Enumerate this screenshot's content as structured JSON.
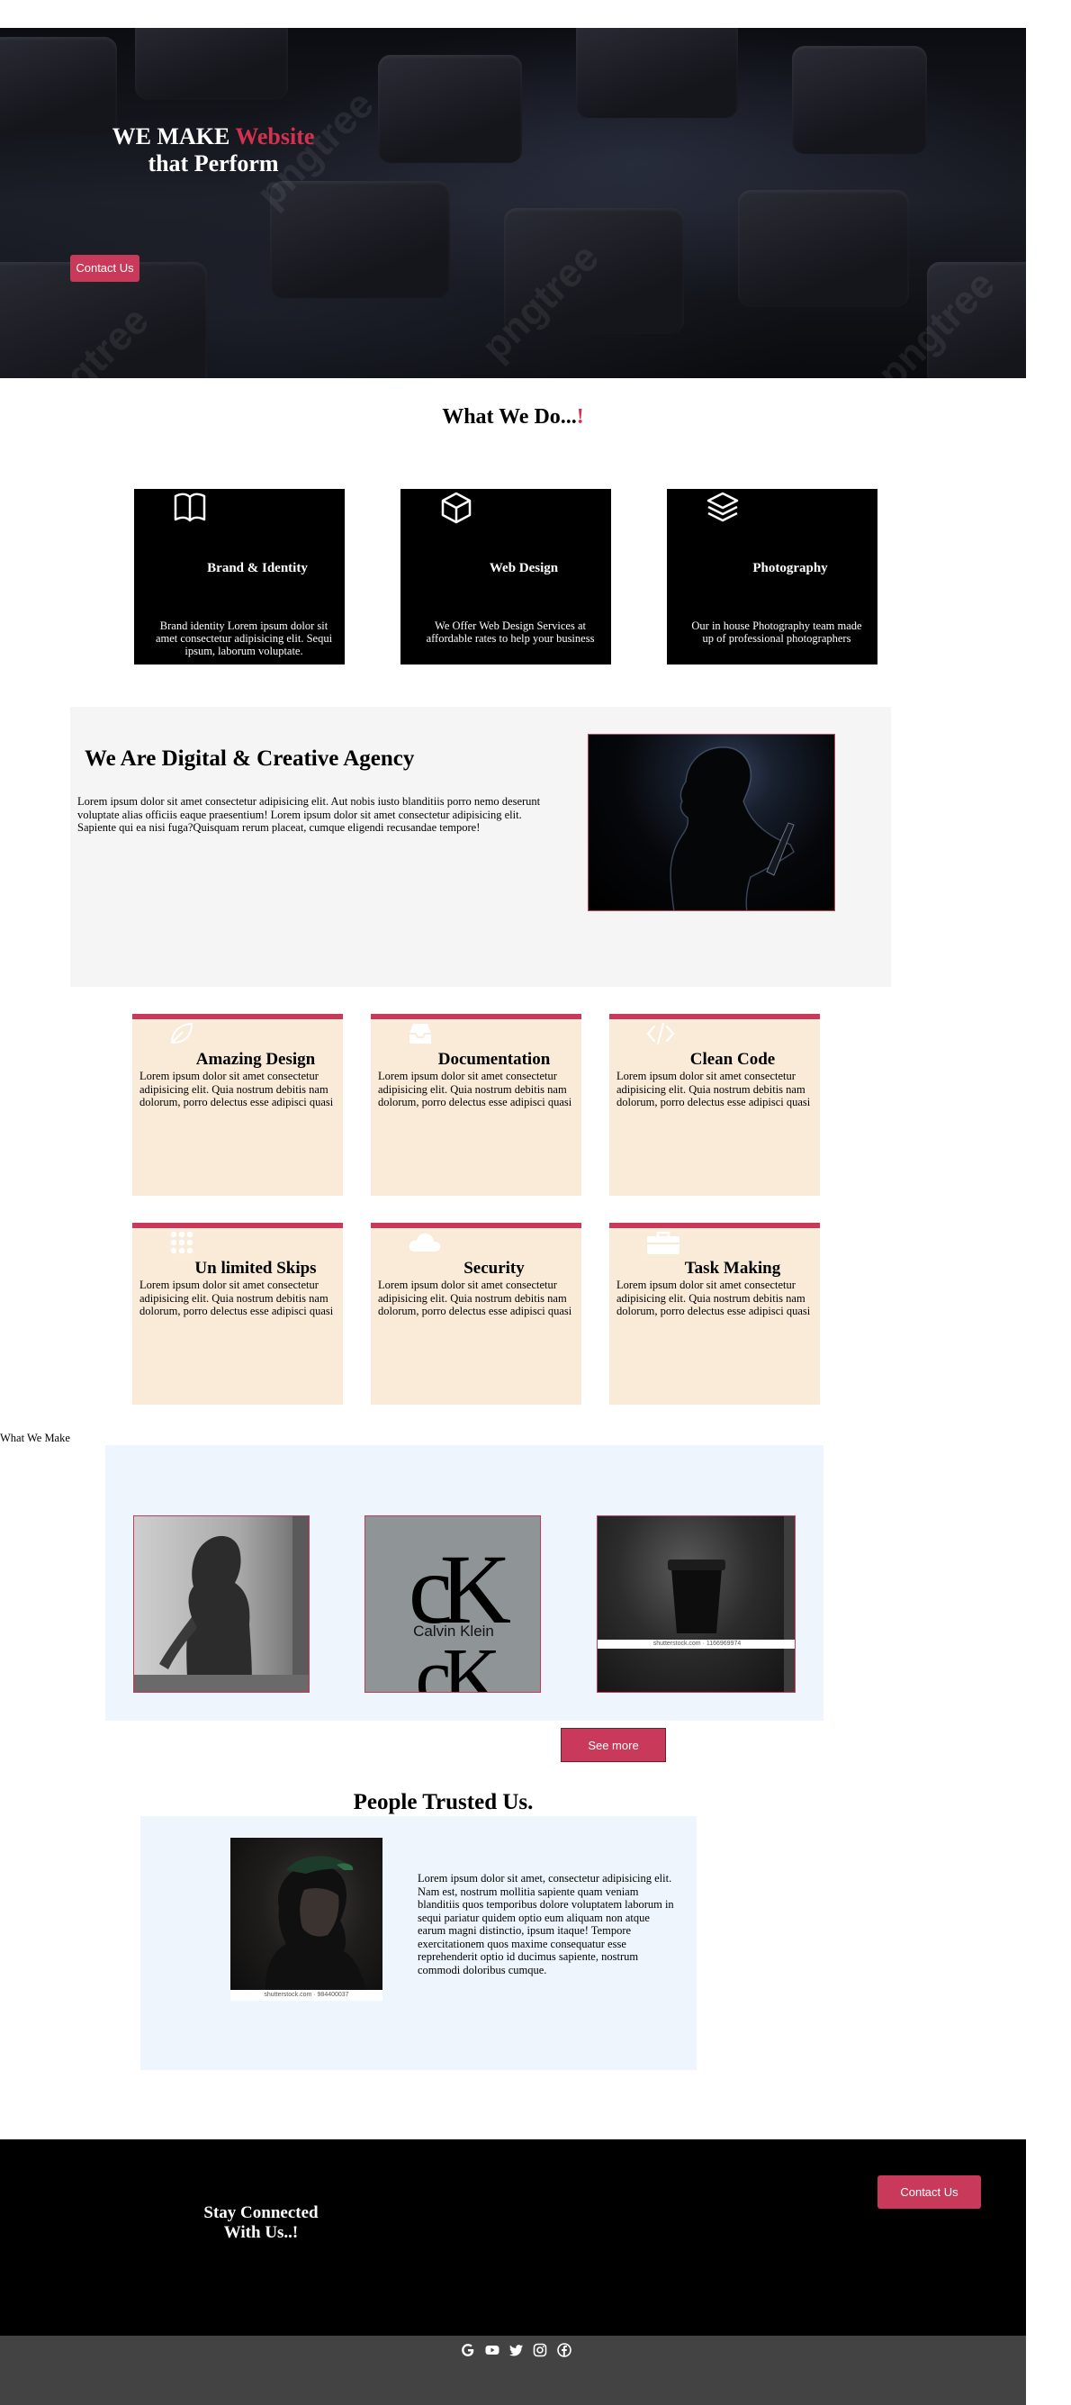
{
  "hero": {
    "title_line1": "WE MAKE ",
    "title_accent": "Website",
    "title_line2": "that Perform",
    "contact_button": "Contact Us",
    "watermark": "pngtree"
  },
  "what_we_do": {
    "title": "What We Do...",
    "title_accent": "!",
    "cards": [
      {
        "icon": "book-icon",
        "title": "Brand & Identity",
        "text": "Brand identity Lorem ipsum dolor sit amet consectetur adipisicing elit. Sequi ipsum, laborum voluptate."
      },
      {
        "icon": "cube-icon",
        "title": "Web Design",
        "text": "We Offer Web Design Services at affordable rates to help your business"
      },
      {
        "icon": "layers-icon",
        "title": "Photography",
        "text": "Our in house Photography team made up of professional photographers"
      }
    ]
  },
  "agency": {
    "title": "We Are Digital & Creative Agency",
    "text": "Lorem ipsum dolor sit amet consectetur adipisicing elit. Aut nobis iusto blanditiis porro nemo deserunt voluptate alias officiis eaque praesentium! Lorem ipsum dolor sit amet consectetur adipisicing elit. Sapiente qui ea nisi fuga?Quisquam rerum placeat, cumque eligendi recusandae tempore!"
  },
  "features": [
    {
      "icon": "leaf-icon",
      "title": "Amazing Design",
      "text": "Lorem ipsum dolor sit amet consectetur adipisicing elit. Quia nostrum debitis nam dolorum, porro delectus esse adipisci quasi"
    },
    {
      "icon": "inbox-icon",
      "title": "Documentation",
      "text": "Lorem ipsum dolor sit amet consectetur adipisicing elit. Quia nostrum debitis nam dolorum, porro delectus esse adipisci quasi"
    },
    {
      "icon": "code-icon",
      "title": "Clean Code",
      "text": "Lorem ipsum dolor sit amet consectetur adipisicing elit. Quia nostrum debitis nam dolorum, porro delectus esse adipisci quasi"
    },
    {
      "icon": "grid-dots-icon",
      "title": "Un limited Skips",
      "text": "Lorem ipsum dolor sit amet consectetur adipisicing elit. Quia nostrum debitis nam dolorum, porro delectus esse adipisci quasi"
    },
    {
      "icon": "cloud-icon",
      "title": "Security",
      "text": "Lorem ipsum dolor sit amet consectetur adipisicing elit. Quia nostrum debitis nam dolorum, porro delectus esse adipisci quasi"
    },
    {
      "icon": "briefcase-icon",
      "title": "Task Making",
      "text": "Lorem ipsum dolor sit amet consectetur adipisicing elit. Quia nostrum debitis nam dolorum, porro delectus esse adipisci quasi"
    }
  ],
  "gallery": {
    "label": "What We Make",
    "ck_logo_text": "Calvin Klein",
    "shutterstock_caption": "shutterstock.com · 1166969974",
    "see_more": "See more"
  },
  "trust": {
    "title": "People Trusted Us.",
    "photo_caption": "shutterstock.com · 984400037",
    "text": "Lorem ipsum dolor sit amet, consectetur adipisicing elit. Nam est, nostrum mollitia sapiente quam veniam blanditiis quos temporibus dolore voluptatem laborum in sequi pariatur quidem optio eum aliquam non atque earum magni distinctio, ipsum itaque! Tempore exercitationem quos maxime consequatur esse reprehenderit optio id ducimus sapiente, nostrum commodi doloribus cumque."
  },
  "footer": {
    "title_line1": "Stay Connected",
    "title_line2": "With Us..!",
    "contact_button": "Contact Us",
    "social_icons": [
      "google-icon",
      "youtube-icon",
      "twitter-icon",
      "instagram-icon",
      "facebook-icon"
    ]
  },
  "colors": {
    "accent": "#c93a5a",
    "card_bg": "#faebd8",
    "panel_bg": "#eef5fd",
    "footer_bg": "#000000",
    "bottom_bar": "#434343"
  }
}
